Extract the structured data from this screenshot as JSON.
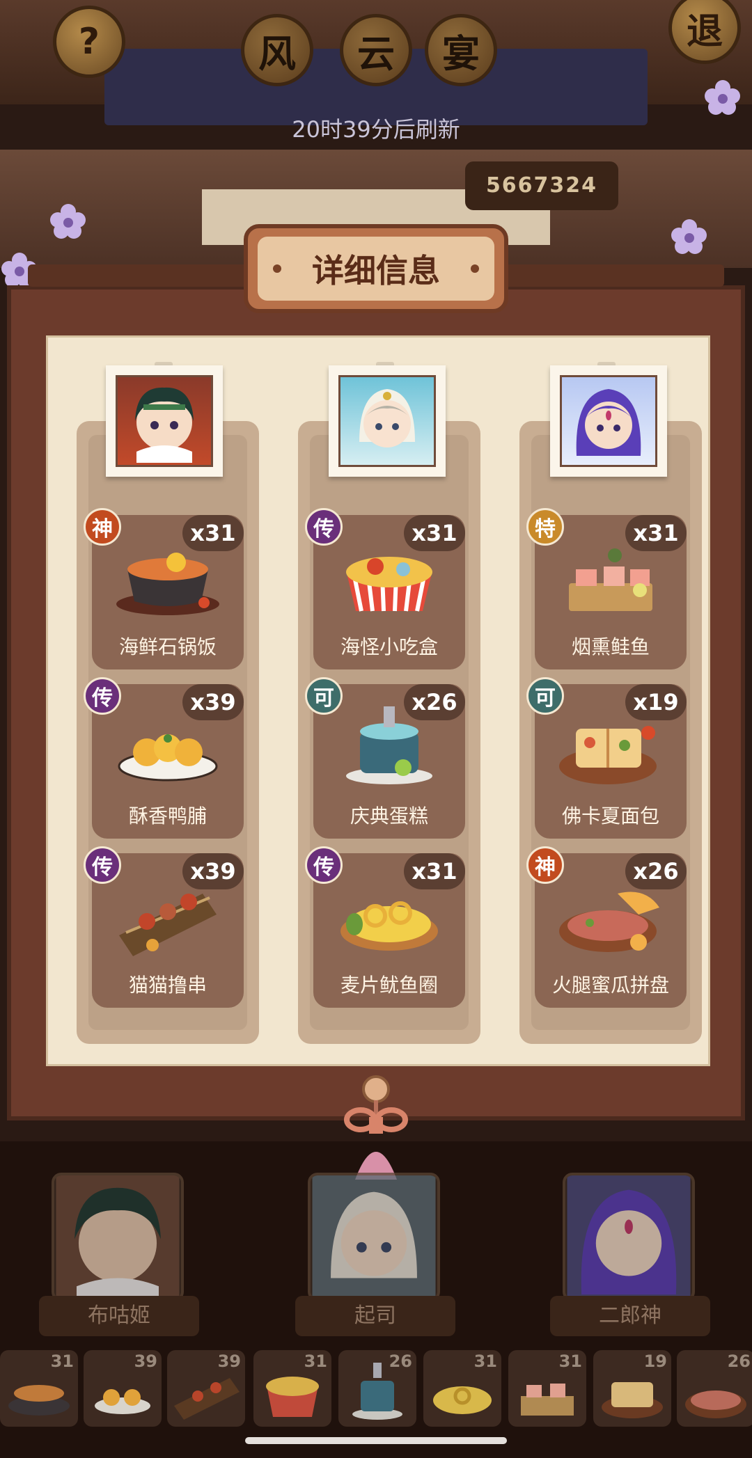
{
  "header": {
    "help_label": "?",
    "title_chars": [
      "风",
      "云",
      "宴"
    ],
    "exit_label": "退",
    "refresh_text": "20时39分后刷新",
    "score": "5667324"
  },
  "modal": {
    "title": "详细信息",
    "columns": [
      {
        "character": "布咕姬",
        "dishes": [
          {
            "name": "海鲜石锅饭",
            "count": "x31",
            "badge": "神",
            "badge_color": "#c24b1f"
          },
          {
            "name": "酥香鸭脯",
            "count": "x39",
            "badge": "传",
            "badge_color": "#6a2f7a"
          },
          {
            "name": "猫猫撸串",
            "count": "x39",
            "badge": "传",
            "badge_color": "#6a2f7a"
          }
        ]
      },
      {
        "character": "起司",
        "dishes": [
          {
            "name": "海怪小吃盒",
            "count": "x31",
            "badge": "传",
            "badge_color": "#6a2f7a"
          },
          {
            "name": "庆典蛋糕",
            "count": "x26",
            "badge": "可",
            "badge_color": "#3e6d6a"
          },
          {
            "name": "麦片鱿鱼圈",
            "count": "x31",
            "badge": "传",
            "badge_color": "#6a2f7a"
          }
        ]
      },
      {
        "character": "二郎神",
        "dishes": [
          {
            "name": "烟熏鲑鱼",
            "count": "x31",
            "badge": "特",
            "badge_color": "#c98a2a"
          },
          {
            "name": "佛卡夏面包",
            "count": "x19",
            "badge": "可",
            "badge_color": "#3e6d6a"
          },
          {
            "name": "火腿蜜瓜拼盘",
            "count": "x26",
            "badge": "神",
            "badge_color": "#c24b1f"
          }
        ]
      }
    ]
  },
  "characters": [
    {
      "name": "布咕姬"
    },
    {
      "name": "起司"
    },
    {
      "name": "二郎神"
    }
  ],
  "dish_bar": [
    "31",
    "39",
    "39",
    "31",
    "26",
    "31",
    "31",
    "19",
    "26"
  ]
}
